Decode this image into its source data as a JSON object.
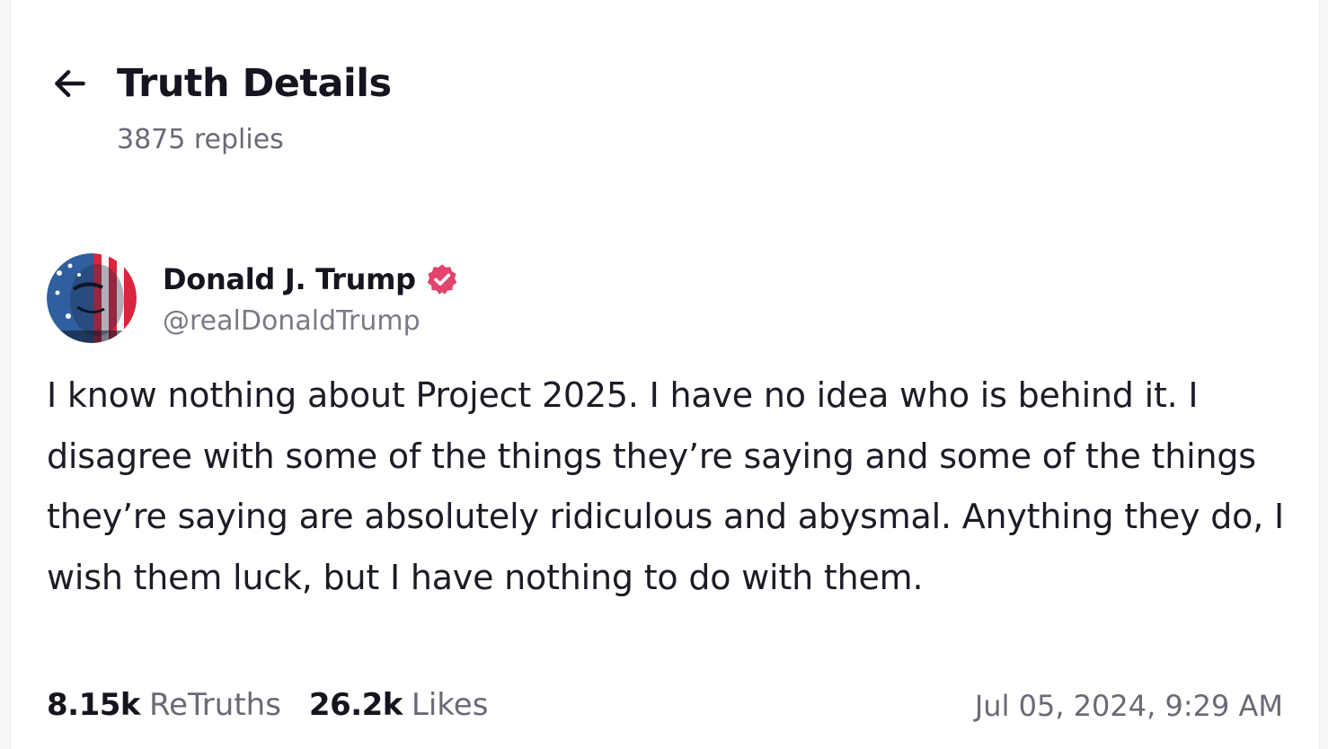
{
  "header": {
    "title": "Truth Details",
    "back_icon": "arrow-left-icon",
    "replies_text": "3875 replies"
  },
  "post": {
    "author": {
      "display_name": "Donald J. Trump",
      "handle": "@realDonaldTrump",
      "verified_icon": "verified-badge-icon",
      "verified_color": "#e2446c"
    },
    "text": "I know nothing about Project 2025. I have no idea who is behind it. I disagree with some of the things they’re saying and some of the things they’re saying are absolutely ridiculous and abysmal. Anything they do, I wish them luck, but I have nothing to do with them.",
    "stats": {
      "retruths_count": "8.15k",
      "retruths_label": "ReTruths",
      "likes_count": "26.2k",
      "likes_label": "Likes"
    },
    "timestamp": "Jul 05, 2024, 9:29 AM"
  }
}
